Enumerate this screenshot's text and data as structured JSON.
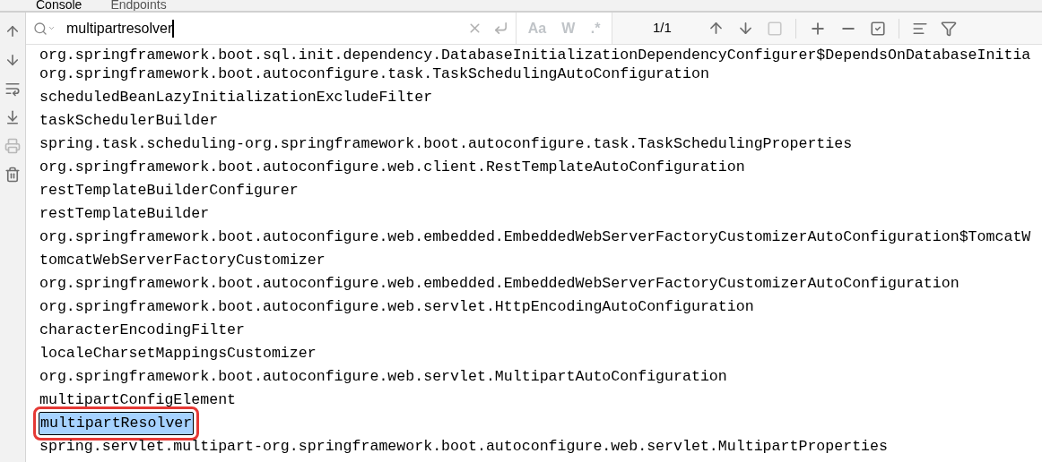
{
  "tabs": [
    {
      "label": "Console",
      "selected": true
    },
    {
      "label": "Endpoints",
      "selected": false
    }
  ],
  "search": {
    "value": "multipartresolver",
    "options": [
      {
        "label": "Aa",
        "on": false
      },
      {
        "label": "W",
        "on": false
      },
      {
        "label": ".*",
        "on": false
      }
    ],
    "match_count": "1/1"
  },
  "lines": [
    {
      "text": "org.springframework.boot.sql.init.dependency.DatabaseInitializationDependencyConfigurer$DependsOnDatabaseInitia",
      "selected": false,
      "outlined": false
    },
    {
      "text": "org.springframework.boot.autoconfigure.task.TaskSchedulingAutoConfiguration",
      "selected": false,
      "outlined": false
    },
    {
      "text": "scheduledBeanLazyInitializationExcludeFilter",
      "selected": false,
      "outlined": false
    },
    {
      "text": "taskSchedulerBuilder",
      "selected": false,
      "outlined": false
    },
    {
      "text": "spring.task.scheduling-org.springframework.boot.autoconfigure.task.TaskSchedulingProperties",
      "selected": false,
      "outlined": false
    },
    {
      "text": "org.springframework.boot.autoconfigure.web.client.RestTemplateAutoConfiguration",
      "selected": false,
      "outlined": false
    },
    {
      "text": "restTemplateBuilderConfigurer",
      "selected": false,
      "outlined": false
    },
    {
      "text": "restTemplateBuilder",
      "selected": false,
      "outlined": false
    },
    {
      "text": "org.springframework.boot.autoconfigure.web.embedded.EmbeddedWebServerFactoryCustomizerAutoConfiguration$TomcatW",
      "selected": false,
      "outlined": false
    },
    {
      "text": "tomcatWebServerFactoryCustomizer",
      "selected": false,
      "outlined": false
    },
    {
      "text": "org.springframework.boot.autoconfigure.web.embedded.EmbeddedWebServerFactoryCustomizerAutoConfiguration",
      "selected": false,
      "outlined": false
    },
    {
      "text": "org.springframework.boot.autoconfigure.web.servlet.HttpEncodingAutoConfiguration",
      "selected": false,
      "outlined": false
    },
    {
      "text": "characterEncodingFilter",
      "selected": false,
      "outlined": false
    },
    {
      "text": "localeCharsetMappingsCustomizer",
      "selected": false,
      "outlined": false
    },
    {
      "text": "org.springframework.boot.autoconfigure.web.servlet.MultipartAutoConfiguration",
      "selected": false,
      "outlined": false
    },
    {
      "text": "multipartConfigElement",
      "selected": false,
      "outlined": false
    },
    {
      "text": "multipartResolver",
      "selected": true,
      "outlined": true
    },
    {
      "text": "spring.servlet.multipart-org.springframework.boot.autoconfigure.web.servlet.MultipartProperties",
      "selected": false,
      "outlined": false
    }
  ]
}
